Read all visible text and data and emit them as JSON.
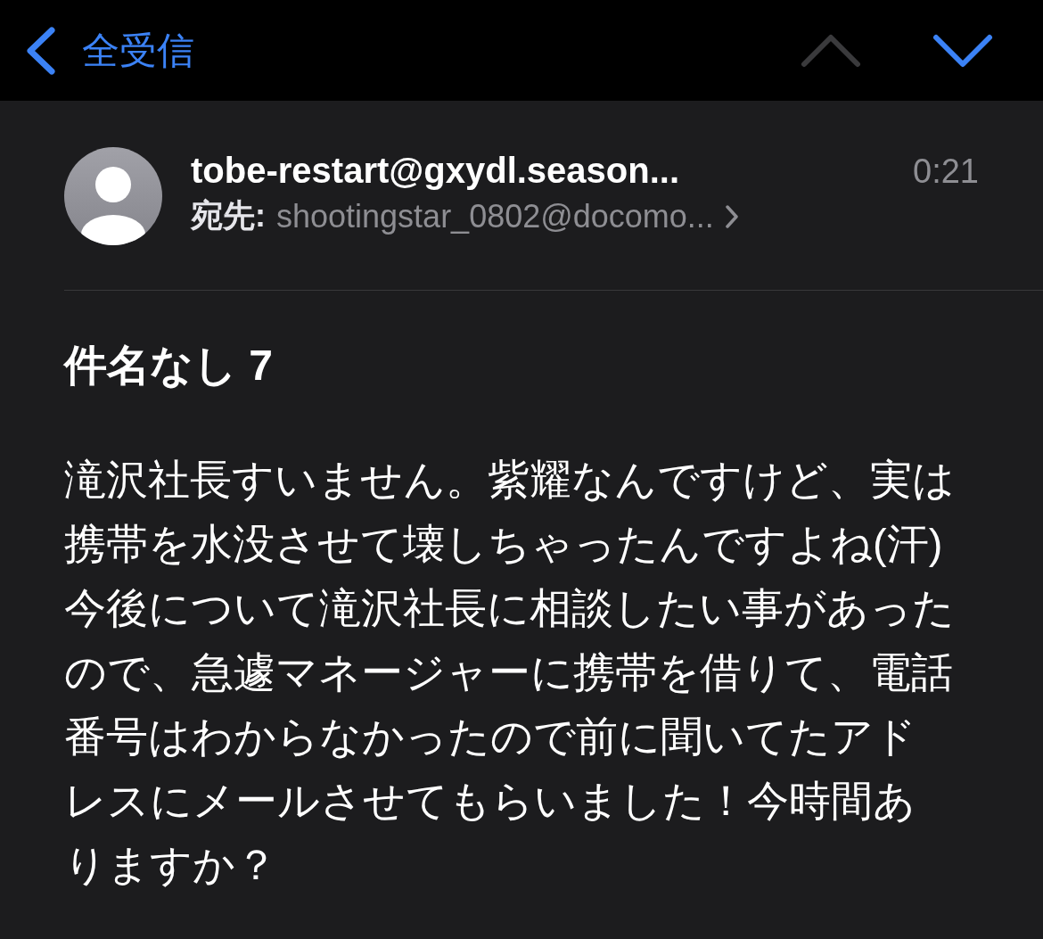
{
  "nav_bar": {
    "back_label": "全受信",
    "nav_buttons": [
      {
        "kind": "up",
        "disabled": true
      },
      {
        "kind": "down",
        "disabled": false
      }
    ]
  },
  "header": {
    "sender": "tobe-restart@gxydl.season...",
    "time": "0:21",
    "to_label": "宛先:",
    "to_address": "shootingstar_0802@docomo..."
  },
  "subject": "件名なし 7",
  "body": "滝沢社長すいません。紫耀なんですけど、実は携帯を水没させて壊しちゃったんですよね(汗)今後について滝沢社長に相談したい事があったので、急遽マネージャーに携帯を借りて、電話番号はわからなかったので前に聞いてたアドレスにメールさせてもらいました！今時間ありますか？"
}
